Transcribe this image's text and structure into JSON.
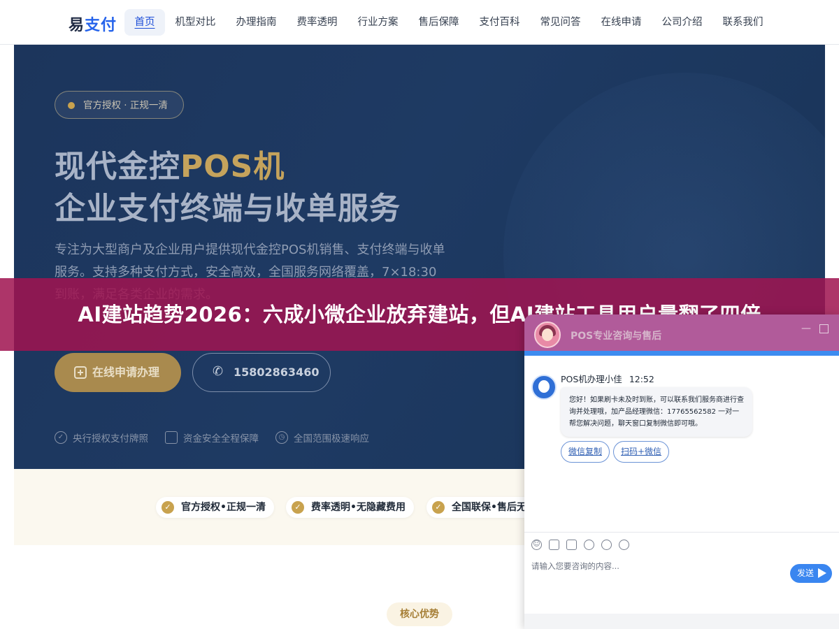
{
  "nav": {
    "logo_prefix": "易",
    "logo_accent": "支付",
    "items": [
      {
        "label": "首页",
        "active": true
      },
      {
        "label": "机型对比"
      },
      {
        "label": "办理指南"
      },
      {
        "label": "费率透明"
      },
      {
        "label": "行业方案"
      },
      {
        "label": "售后保障"
      },
      {
        "label": "支付百科"
      },
      {
        "label": "常见问答"
      },
      {
        "label": "在线申请"
      },
      {
        "label": "公司介绍"
      },
      {
        "label": "联系我们"
      }
    ]
  },
  "hero": {
    "badge": "官方授权 · 正规一清",
    "title_line1_plain": "现代金控",
    "title_line1_highlight": "POS机",
    "title_line2": "企业支付终端与收单服务",
    "description": "专注为大型商户及企业用户提供现代金控POS机销售、支付终端与收单服务。支持多种支付方式，安全高效，全国服务网络覆盖，7×18:30到账，满足各类企业的需求。",
    "apply_button": "在线申请办理",
    "phone_button": "15802863460",
    "features": [
      "央行授权支付牌照",
      "资金安全全程保障",
      "全国范围极速响应"
    ]
  },
  "strip": {
    "pills": [
      "官方授权•正规一清",
      "费率透明•无隐藏费用",
      "全国联保•售后无"
    ]
  },
  "section": {
    "core_label": "核心优势"
  },
  "headline": "AI建站趋势2026：六成小微企业放弃建站，但AI建站工具用户量翻了四倍",
  "chat": {
    "title": "POS专业咨询与售后",
    "agent_name": "POS机办理小佳",
    "time": "12:52",
    "message": "您好！如果刷卡未及时到账，可以联系我们服务商进行查询并处理哦，加产品经理微信：17765562582 一对一帮您解决问题，聊天窗口复制微信即可哦。",
    "quick_buttons": [
      "微信复制",
      "扫码+微信"
    ],
    "input_placeholder": "请输入您要咨询的内容...",
    "send_label": "发送"
  }
}
